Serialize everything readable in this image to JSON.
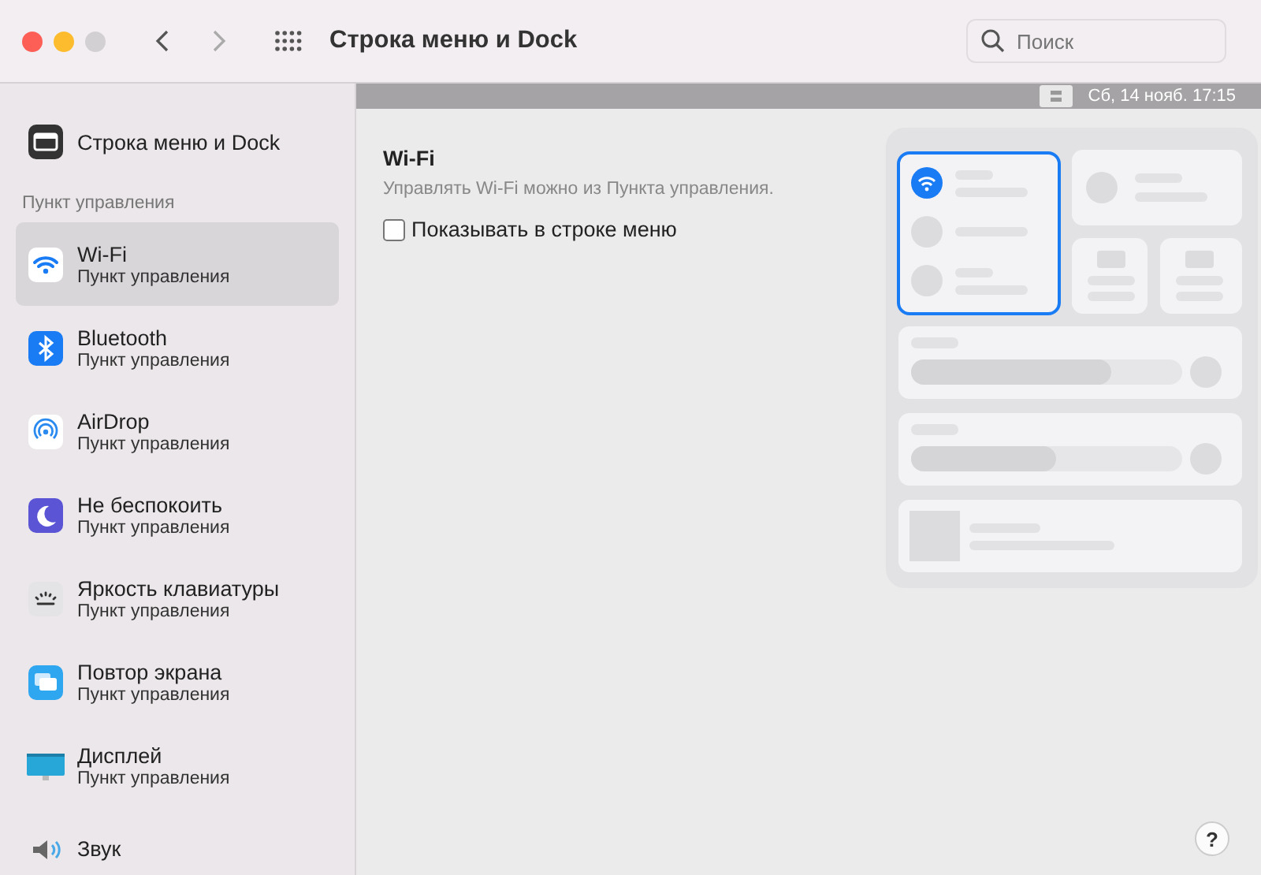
{
  "window": {
    "title": "Строка меню и Dock"
  },
  "search": {
    "placeholder": "Поиск"
  },
  "menubar_preview": {
    "datetime": "Сб, 14 нояб.  17:15"
  },
  "sidebar": {
    "top_item": {
      "label": "Строка меню и Dock",
      "kind": "menubar",
      "selected": false
    },
    "section": "Пункт управления",
    "items": [
      {
        "label": "Wi-Fi",
        "subtitle": "Пункт управления",
        "kind": "wifi",
        "selected": true
      },
      {
        "label": "Bluetooth",
        "subtitle": "Пункт управления",
        "kind": "bluetooth",
        "selected": false
      },
      {
        "label": "AirDrop",
        "subtitle": "Пункт управления",
        "kind": "airdrop",
        "selected": false
      },
      {
        "label": "Не беспокоить",
        "subtitle": "Пункт управления",
        "kind": "moon",
        "selected": false
      },
      {
        "label": "Яркость клавиатуры",
        "subtitle": "Пункт управления",
        "kind": "keyboard",
        "selected": false
      },
      {
        "label": "Повтор экрана",
        "subtitle": "Пункт управления",
        "kind": "mirror",
        "selected": false
      },
      {
        "label": "Дисплей",
        "subtitle": "Пункт управления",
        "kind": "display",
        "selected": false
      },
      {
        "label": "Звук",
        "kind": "sound",
        "selected": false
      }
    ]
  },
  "detail": {
    "title": "Wi-Fi",
    "description": "Управлять Wi-Fi можно из Пункта управления.",
    "checkbox": {
      "label": "Показывать в строке меню",
      "checked": false
    }
  },
  "help": "?"
}
